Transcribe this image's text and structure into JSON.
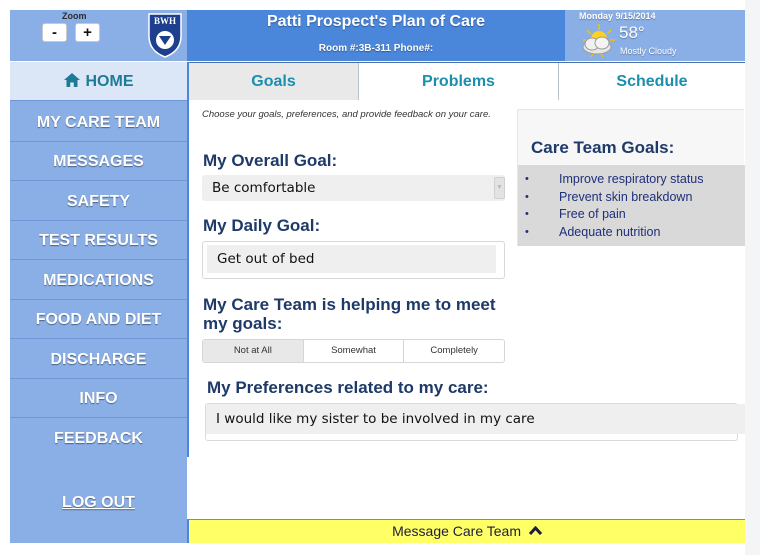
{
  "header": {
    "zoom_label": "Zoom",
    "zoom_out_label": "-",
    "zoom_in_label": "+",
    "logo_text": "BWH",
    "title": "Patti Prospect's Plan of Care",
    "room_line": "Room #:3B-311 Phone#:",
    "weather": {
      "date": "Monday 9/15/2014",
      "temperature": "58°",
      "condition": "Mostly Cloudy",
      "icon": "partly-cloudy-icon"
    }
  },
  "sidebar": {
    "items": [
      {
        "label": "HOME",
        "icon": "home-icon",
        "active": true
      },
      {
        "label": "MY CARE TEAM"
      },
      {
        "label": "MESSAGES"
      },
      {
        "label": "SAFETY"
      },
      {
        "label": "TEST RESULTS"
      },
      {
        "label": "MEDICATIONS"
      },
      {
        "label": "FOOD AND DIET"
      },
      {
        "label": "DISCHARGE"
      },
      {
        "label": "INFO"
      },
      {
        "label": "FEEDBACK"
      }
    ],
    "logout_label": "LOG OUT"
  },
  "tabs": [
    {
      "label": "Goals",
      "active": true
    },
    {
      "label": "Problems"
    },
    {
      "label": "Schedule"
    }
  ],
  "goals": {
    "intro": "Choose your goals, preferences, and provide feedback on your care.",
    "overall_goal_heading": "My Overall Goal:",
    "overall_goal_value": "Be comfortable",
    "daily_goal_heading": "My Daily Goal:",
    "daily_goal_value": "Get out of bed",
    "helping_heading": "My Care Team is helping me to meet my goals:",
    "helping_options": [
      "Not at All",
      "Somewhat",
      "Completely"
    ],
    "helping_selected": "Not at All",
    "preferences_heading": "My Preferences related to my care:",
    "preferences_value": "I would like my sister to be involved in my care"
  },
  "care_team_goals": {
    "title": "Care Team Goals:",
    "items": [
      "Improve respiratory status",
      "Prevent skin breakdown",
      "Free of pain",
      "Adequate nutrition"
    ]
  },
  "footer": {
    "message_label": "Message Care Team",
    "icon": "chevron-up-icon"
  },
  "colors": {
    "header_blue": "#4a86da",
    "sidebar_blue": "#8aafe6",
    "tab_text": "#1a8fae",
    "heading_navy": "#1e3a68",
    "footer_yellow": "#ffff66"
  }
}
